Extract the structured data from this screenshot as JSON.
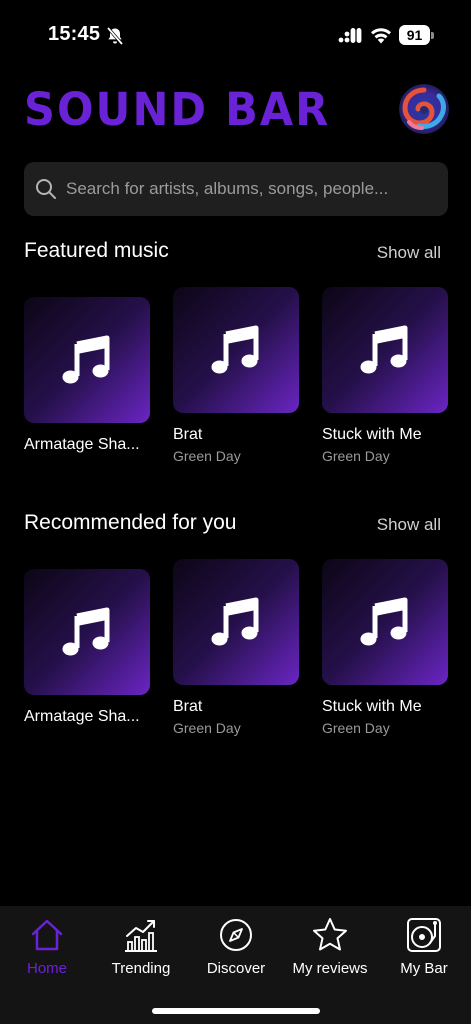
{
  "status_bar": {
    "time": "15:45",
    "battery": "91",
    "icons": [
      "bell-slash-icon",
      "cellular-signal-icon",
      "wifi-icon",
      "battery-icon"
    ]
  },
  "header": {
    "logo_text": "SOUND BAR",
    "logo_color": "#6a22d6"
  },
  "search": {
    "placeholder": "Search for artists, albums, songs, people..."
  },
  "sections": [
    {
      "title": "Featured music",
      "show_all": "Show all",
      "items": [
        {
          "title": "Armatage Sha...",
          "subtitle": ""
        },
        {
          "title": "Brat",
          "subtitle": "Green Day"
        },
        {
          "title": "Stuck with Me",
          "subtitle": "Green Day"
        }
      ]
    },
    {
      "title": "Recommended for you",
      "show_all": "Show all",
      "items": [
        {
          "title": "Armatage Sha...",
          "subtitle": ""
        },
        {
          "title": "Brat",
          "subtitle": "Green Day"
        },
        {
          "title": "Stuck with Me",
          "subtitle": "Green Day"
        }
      ]
    }
  ],
  "nav": {
    "items": [
      {
        "label": "Home",
        "icon": "home-icon",
        "active": true
      },
      {
        "label": "Trending",
        "icon": "trending-chart-icon"
      },
      {
        "label": "Discover",
        "icon": "compass-icon"
      },
      {
        "label": "My reviews",
        "icon": "star-icon"
      },
      {
        "label": "My Bar",
        "icon": "turntable-icon"
      }
    ],
    "active_color": "#6a22d6"
  }
}
